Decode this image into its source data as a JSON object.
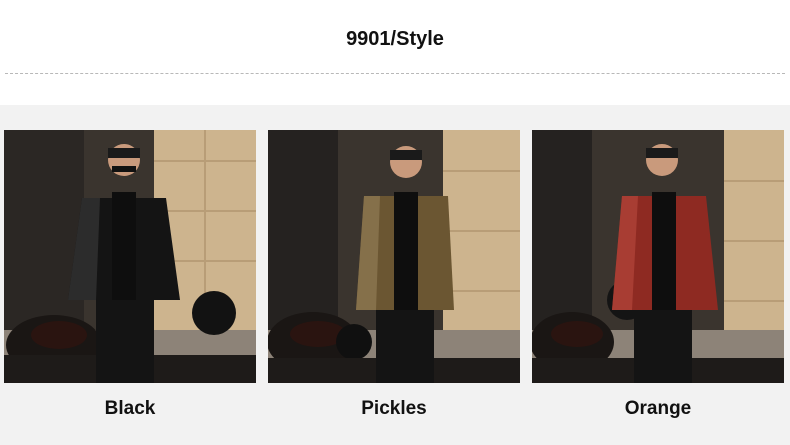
{
  "title": "9901/Style",
  "variants": [
    {
      "label": "Black",
      "jacket_color": "#141414",
      "jacket_shade": "#2c2c2c"
    },
    {
      "label": "Pickles",
      "jacket_color": "#6b5632",
      "jacket_shade": "#85704a"
    },
    {
      "label": "Orange",
      "jacket_color": "#8e2a22",
      "jacket_shade": "#a83d33"
    }
  ]
}
